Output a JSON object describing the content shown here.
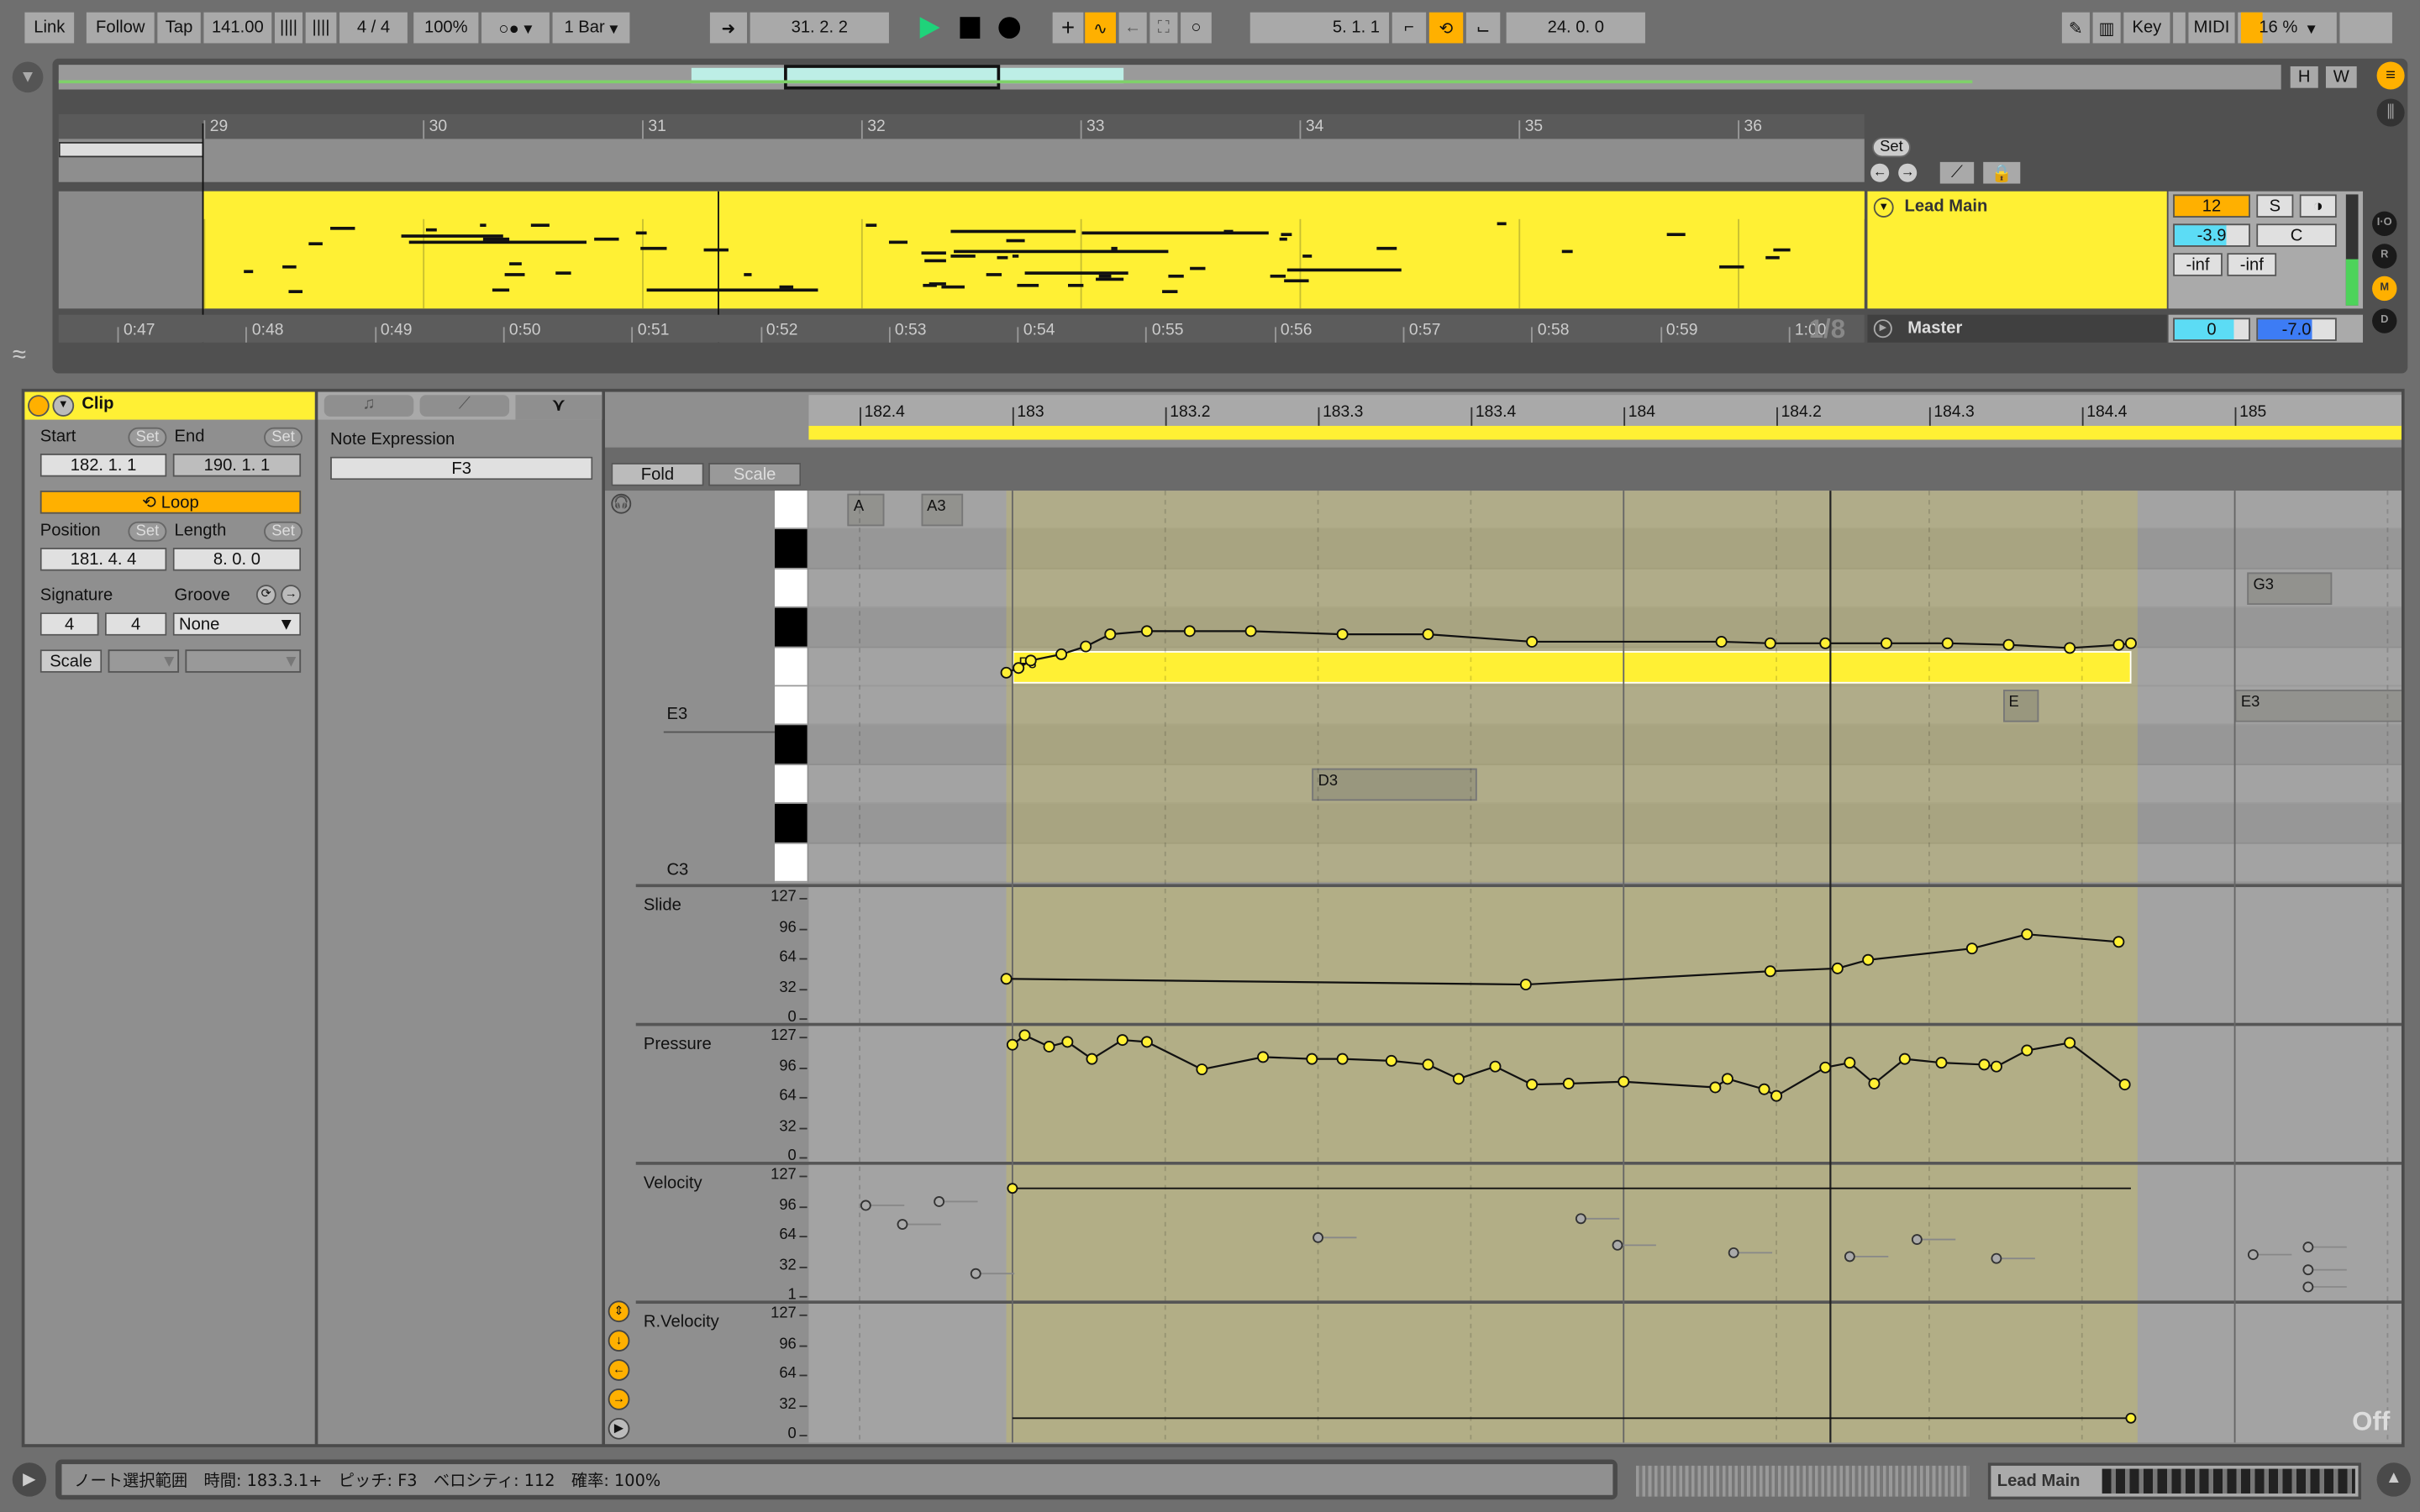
{
  "toolbar": {
    "link": "Link",
    "follow": "Follow",
    "tap": "Tap",
    "tempo": "141.00",
    "signature": "4 / 4",
    "zoom": "100%",
    "quantize": "1 Bar",
    "position": "31.  2.  2",
    "loop_start": "5.  1.  1",
    "loop_length": "24.  0.  0",
    "key": "Key",
    "midi": "MIDI",
    "cpu": "16 %",
    "accent": "#ffb000",
    "play_color": "#1fd37a"
  },
  "arrangement": {
    "bars": [
      "29",
      "30",
      "31",
      "32",
      "33",
      "34",
      "35",
      "36"
    ],
    "times": [
      "0:47",
      "0:48",
      "0:49",
      "0:50",
      "0:51",
      "0:52",
      "0:53",
      "0:54",
      "0:55",
      "0:56",
      "0:57",
      "0:58",
      "0:59",
      "1:00"
    ],
    "fraction": "1/8",
    "set": "Set",
    "h": "H",
    "w": "W",
    "clip_color": "#fff034"
  },
  "track": {
    "name": "Lead Main",
    "channel": "12",
    "solo": "S",
    "volume": "-3.9",
    "volume_fill": 0.7,
    "pan": "C",
    "send_a": "-inf",
    "send_b": "-inf"
  },
  "master": {
    "name": "Master",
    "volume": "0",
    "cue": "-7.0"
  },
  "side_buttons": [
    "I·O",
    "R",
    "M",
    "D"
  ],
  "clip": {
    "title": "Clip",
    "start_label": "Start",
    "end_label": "End",
    "set": "Set",
    "start": "182.   1.   1",
    "end": "190.   1.   1",
    "loop": "Loop",
    "position_label": "Position",
    "length_label": "Length",
    "position": "181.   4.   4",
    "length": "8.   0.   0",
    "signature_label": "Signature",
    "groove_label": "Groove",
    "sig_num": "4",
    "sig_den": "4",
    "groove": "None",
    "scale": "Scale"
  },
  "note_expression": {
    "title": "Note Expression",
    "note": "F3"
  },
  "editor": {
    "fold": "Fold",
    "scale": "Scale",
    "ruler": [
      "182.4",
      "183",
      "183.2",
      "183.3",
      "183.4",
      "184",
      "184.2",
      "184.3",
      "184.4",
      "185"
    ],
    "notes": [
      {
        "name": "F3",
        "start": 183.0,
        "end": 184.83,
        "selected": true
      },
      {
        "name": "A",
        "start": 182.73,
        "end": 182.79
      },
      {
        "name": "A3",
        "start": 182.85,
        "end": 182.92
      },
      {
        "name": "G3",
        "start": 185.02,
        "end": 185.16
      },
      {
        "name": "E",
        "start": 184.62,
        "end": 184.68
      },
      {
        "name": "E3",
        "start": 185.0,
        "end": 185.3
      },
      {
        "name": "D3",
        "start": 183.49,
        "end": 183.76
      }
    ],
    "key_labels": [
      "E3",
      "C3"
    ],
    "off": "Off"
  },
  "lanes": [
    {
      "name": "Slide",
      "ticks": [
        "127",
        "96",
        "64",
        "32",
        "0"
      ]
    },
    {
      "name": "Pressure",
      "ticks": [
        "127",
        "96",
        "64",
        "32",
        "0"
      ]
    },
    {
      "name": "Velocity",
      "ticks": [
        "127",
        "96",
        "64",
        "32",
        "1"
      ]
    },
    {
      "name": "R.Velocity",
      "ticks": [
        "127",
        "96",
        "64",
        "32",
        "0"
      ]
    }
  ],
  "expression": {
    "pitch_bend_semitones": [
      [
        182.99,
        0
      ],
      [
        183.01,
        0.12
      ],
      [
        183.03,
        0.31
      ],
      [
        183.08,
        0.47
      ],
      [
        183.12,
        0.67
      ],
      [
        183.16,
        0.98
      ],
      [
        183.22,
        1.06
      ],
      [
        183.29,
        1.06
      ],
      [
        183.39,
        1.06
      ],
      [
        183.54,
        0.98
      ],
      [
        183.68,
        0.98
      ],
      [
        183.85,
        0.79
      ],
      [
        184.16,
        0.79
      ],
      [
        184.24,
        0.75
      ],
      [
        184.33,
        0.75
      ],
      [
        184.43,
        0.75
      ],
      [
        184.53,
        0.75
      ],
      [
        184.63,
        0.71
      ],
      [
        184.73,
        0.63
      ],
      [
        184.81,
        0.71
      ],
      [
        184.83,
        0.75
      ]
    ],
    "slide": [
      [
        182.99,
        40
      ],
      [
        183.84,
        34
      ],
      [
        184.24,
        48
      ],
      [
        184.35,
        51
      ],
      [
        184.4,
        60
      ],
      [
        184.57,
        72
      ],
      [
        184.66,
        87
      ],
      [
        184.81,
        79
      ]
    ],
    "pressure": [
      [
        183.0,
        117
      ],
      [
        183.02,
        127
      ],
      [
        183.06,
        115
      ],
      [
        183.09,
        120
      ],
      [
        183.13,
        102
      ],
      [
        183.18,
        122
      ],
      [
        183.22,
        120
      ],
      [
        183.31,
        91
      ],
      [
        183.41,
        104
      ],
      [
        183.49,
        102
      ],
      [
        183.54,
        102
      ],
      [
        183.62,
        100
      ],
      [
        183.68,
        96
      ],
      [
        183.73,
        81
      ],
      [
        183.79,
        94
      ],
      [
        183.85,
        75
      ],
      [
        183.91,
        76
      ],
      [
        184.0,
        78
      ],
      [
        184.15,
        72
      ],
      [
        184.17,
        81
      ],
      [
        184.23,
        70
      ],
      [
        184.25,
        63
      ],
      [
        184.33,
        93
      ],
      [
        184.37,
        98
      ],
      [
        184.41,
        76
      ],
      [
        184.46,
        102
      ],
      [
        184.52,
        98
      ],
      [
        184.59,
        96
      ],
      [
        184.61,
        94
      ],
      [
        184.66,
        111
      ],
      [
        184.73,
        119
      ],
      [
        184.82,
        75
      ]
    ],
    "velocity": 112,
    "release_velocity": 16
  },
  "ghost_velocities": [
    [
      182.76,
      94
    ],
    [
      182.82,
      74
    ],
    [
      182.88,
      98
    ],
    [
      182.94,
      22
    ],
    [
      183.5,
      60
    ],
    [
      183.93,
      80
    ],
    [
      183.99,
      52
    ],
    [
      184.18,
      44
    ],
    [
      184.37,
      40
    ],
    [
      184.48,
      58
    ],
    [
      184.61,
      38
    ],
    [
      185.03,
      42
    ],
    [
      185.12,
      50
    ],
    [
      185.12,
      26
    ],
    [
      185.12,
      8
    ]
  ],
  "status": {
    "text": "ノート選択範囲　時間: 183.3.1+　ピッチ: F3　ベロシティ: 112　確率: 100%",
    "track": "Lead Main"
  }
}
